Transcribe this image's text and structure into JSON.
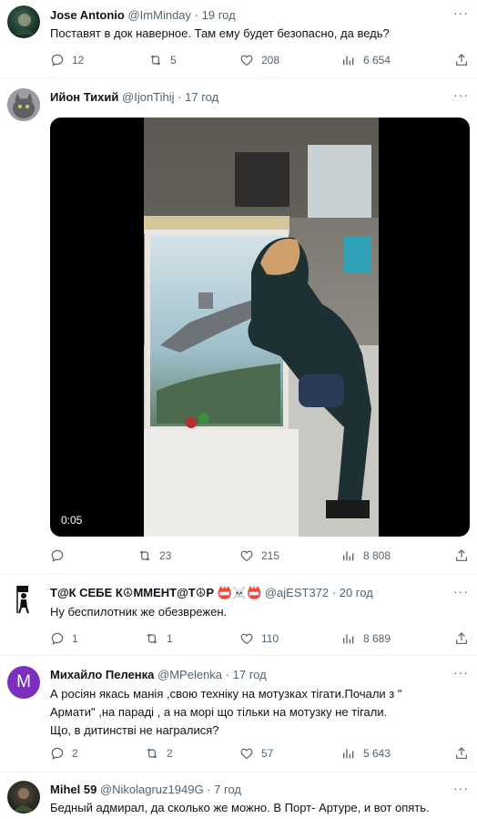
{
  "tweets": [
    {
      "name": "Jose Antonio",
      "handle": "@ImMinday",
      "dot": "·",
      "time": "19 год",
      "text": "Поставят в док наверное. Там ему будет безопасно, да ведь?",
      "replies": "12",
      "retweets": "5",
      "likes": "208",
      "views": "6 654"
    },
    {
      "name": "Ийон Тихий",
      "handle": "@IjonTihij",
      "dot": "·",
      "time": "17 год",
      "video_time": "0:05",
      "replies": "",
      "retweets": "23",
      "likes": "215",
      "views": "8 808"
    },
    {
      "name": "Т@К СЕБЕ К☮ММЕНТ@Т☮Р 📛☠️📛",
      "handle": "@ajEST372",
      "dot": "·",
      "time": "20 год",
      "text": "Ну беспилотник же обезврежен.",
      "replies": "1",
      "retweets": "1",
      "likes": "110",
      "views": "8 689"
    },
    {
      "name": "Михайло Пеленка",
      "handle": "@MPelenka",
      "dot": "·",
      "time": "17 год",
      "avatar_letter": "M",
      "text_lines": [
        "А росіян якась манія ,свою техніку на мотузках тігати.Почали з \"",
        "Армати\" ,на параді , а на морі що тільки на мотузку не тігали.",
        "Що, в дитинстві не награлися?"
      ],
      "replies": "2",
      "retweets": "2",
      "likes": "57",
      "views": "5 643"
    },
    {
      "name": "Mihel 59",
      "handle": "@Nikolagruz1949G",
      "dot": "·",
      "time": "7 год",
      "text": "Бедный адмирал, да сколько же можно. В Порт- Артуре, и вот опять."
    }
  ],
  "colors": {
    "avatar_purple": "#7b2fbe",
    "icon_gray": "#536471"
  }
}
